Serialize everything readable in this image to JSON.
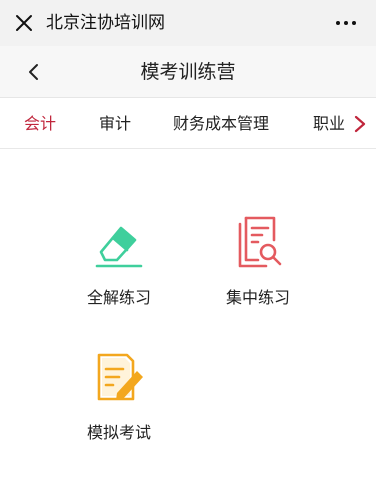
{
  "wechat_bar": {
    "title": "北京注协培训网"
  },
  "header": {
    "title": "模考训练营"
  },
  "tabs": [
    {
      "label": "会计",
      "active": true
    },
    {
      "label": "审计",
      "active": false
    },
    {
      "label": "财务成本管理",
      "active": false
    },
    {
      "label": "职业",
      "active": false
    }
  ],
  "modules": [
    {
      "label": "全解练习",
      "icon": "pencil-eraser-icon",
      "color": "#3fcf9c"
    },
    {
      "label": "集中练习",
      "icon": "document-search-icon",
      "color": "#e45a5f"
    },
    {
      "label": "模拟考试",
      "icon": "exam-paper-pencil-icon",
      "color": "#f3a71e"
    }
  ],
  "colors": {
    "accent": "#c0263c"
  }
}
